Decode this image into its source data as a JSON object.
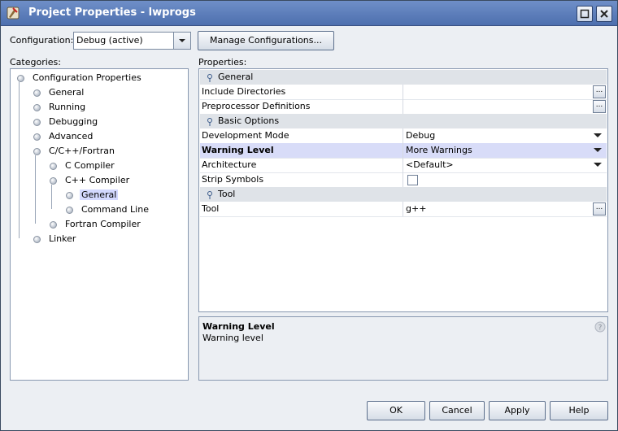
{
  "window": {
    "title": "Project Properties - lwprogs"
  },
  "configuration": {
    "label": "Configuration:",
    "value": "Debug (active)",
    "manage_label": "Manage Configurations..."
  },
  "categories": {
    "label": "Categories:",
    "items": [
      {
        "label": "Configuration Properties"
      },
      {
        "label": "General"
      },
      {
        "label": "Running"
      },
      {
        "label": "Debugging"
      },
      {
        "label": "Advanced"
      },
      {
        "label": "C/C++/Fortran"
      },
      {
        "label": "C Compiler"
      },
      {
        "label": "C++ Compiler"
      },
      {
        "label": "General"
      },
      {
        "label": "Command Line"
      },
      {
        "label": "Fortran Compiler"
      },
      {
        "label": "Linker"
      }
    ]
  },
  "properties": {
    "label": "Properties:",
    "groups": [
      {
        "name": "General",
        "rows": [
          {
            "name": "Include Directories",
            "value": ""
          },
          {
            "name": "Preprocessor Definitions",
            "value": ""
          }
        ]
      },
      {
        "name": "Basic Options",
        "rows": [
          {
            "name": "Development Mode",
            "value": "Debug"
          },
          {
            "name": "Warning Level",
            "value": "More Warnings"
          },
          {
            "name": "Architecture",
            "value": "<Default>"
          },
          {
            "name": "Strip Symbols",
            "value": ""
          }
        ]
      },
      {
        "name": "Tool",
        "rows": [
          {
            "name": "Tool",
            "value": "g++"
          }
        ]
      }
    ],
    "ellipsis": "..."
  },
  "description": {
    "title": "Warning Level",
    "text": "Warning level"
  },
  "buttons": {
    "ok": "OK",
    "cancel": "Cancel",
    "apply": "Apply",
    "help": "Help"
  }
}
